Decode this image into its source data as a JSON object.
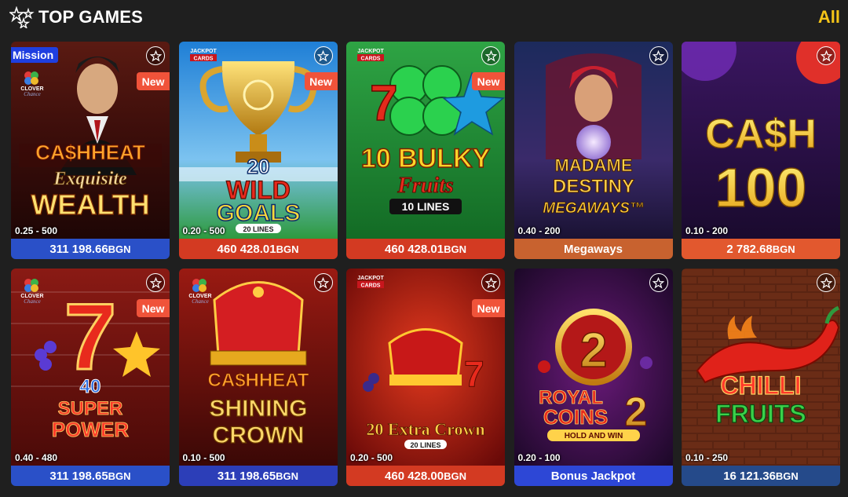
{
  "header": {
    "title": "TOP GAMES",
    "all_label": "All"
  },
  "games": [
    {
      "bet_range": "0.25 - 500",
      "jackpot_amount": "311 198.66",
      "currency": "BGN",
      "badge_mission": "Mission",
      "badge_new": "New",
      "art_lines": [
        "CA$HHEAT",
        "Exquisite",
        "WEALTH"
      ]
    },
    {
      "bet_range": "0.20 - 500",
      "jackpot_amount": "460 428.01",
      "currency": "BGN",
      "badge_new": "New",
      "art_lines": [
        "20",
        "WILD",
        "GOALS",
        "20 LINES"
      ]
    },
    {
      "bet_range": "",
      "jackpot_amount": "460 428.01",
      "currency": "BGN",
      "badge_new": "New",
      "art_lines": [
        "10 BULKY",
        "Fruits",
        "10 LINES"
      ]
    },
    {
      "bet_range": "0.40 - 200",
      "footer_label": "Megaways",
      "art_lines": [
        "MADAME",
        "DESTINY",
        "MEGAWAYS™"
      ]
    },
    {
      "bet_range": "0.10 - 200",
      "jackpot_amount": "2 782.68",
      "currency": "BGN",
      "art_lines": [
        "CA$H",
        "100"
      ]
    },
    {
      "bet_range": "0.40 - 480",
      "jackpot_amount": "311 198.65",
      "currency": "BGN",
      "badge_new": "New",
      "art_lines": [
        "7",
        "40",
        "SUPER",
        "POWER"
      ]
    },
    {
      "bet_range": "0.10 - 500",
      "jackpot_amount": "311 198.65",
      "currency": "BGN",
      "art_lines": [
        "CA$HHEAT",
        "SHINING",
        "CROWN"
      ]
    },
    {
      "bet_range": "0.20 - 500",
      "jackpot_amount": "460 428.00",
      "currency": "BGN",
      "badge_new": "New",
      "art_lines": [
        "20 Extra Crown",
        "20 LINES"
      ]
    },
    {
      "bet_range": "0.20 - 100",
      "footer_label": "Bonus Jackpot",
      "art_lines": [
        "2",
        "ROYAL",
        "COINS",
        "2",
        "HOLD AND WIN"
      ]
    },
    {
      "bet_range": "0.10 - 250",
      "jackpot_amount": "16 121.36",
      "currency": "BGN",
      "art_lines": [
        "CHILLI",
        "FRUITS"
      ]
    }
  ],
  "logos": {
    "clover": [
      "CLOVER",
      "Chance"
    ],
    "jackpot_cards": [
      "JACKPOT",
      "CARDS"
    ]
  },
  "colors": {
    "accent_all": "#f5c518",
    "new_badge": "#f0533a",
    "mission_badge": "#1f3fe0",
    "bar_blue": "#2a50c8",
    "bar_red": "#d33a22"
  }
}
